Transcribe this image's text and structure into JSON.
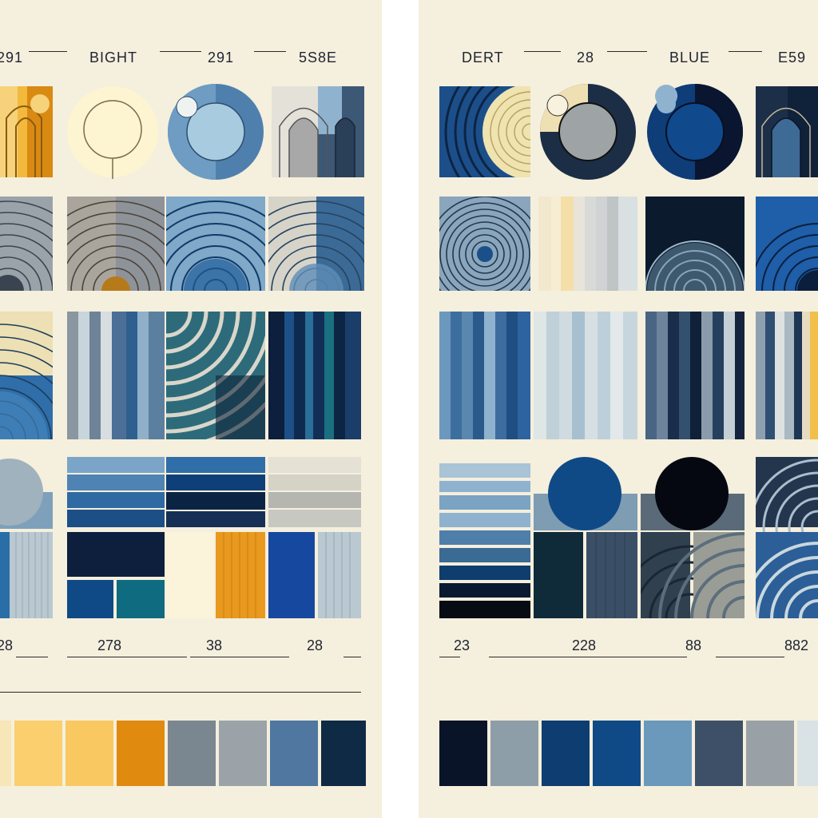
{
  "left_panel": {
    "headers": [
      "291",
      "BIGHT",
      "291",
      "5S8E"
    ],
    "numbers": [
      "28",
      "278",
      "38",
      "28"
    ],
    "palette": [
      "#f7e6b8",
      "#fbcf6e",
      "#f9c861",
      "#e08a10",
      "#7b8790",
      "#9ba3a9",
      "#4f77a0",
      "#0f2a45"
    ]
  },
  "right_panel": {
    "headers": [
      "DERT",
      "28",
      "BLUE",
      "E59"
    ],
    "numbers": [
      "23",
      "228",
      "88",
      "882"
    ],
    "palette": [
      "#0a1428",
      "#8e9ea8",
      "#0e3d72",
      "#0f4a86",
      "#6a99bb",
      "#3e5068",
      "#9aa1a6",
      "#d9e3e6"
    ]
  },
  "colors": {
    "cream": "#f5efdd",
    "navy": "#0d2340",
    "blue": "#0f4a86",
    "sky": "#8fb3cf",
    "gray": "#8c959b",
    "orange": "#e08a10",
    "gold": "#f3c45c"
  }
}
